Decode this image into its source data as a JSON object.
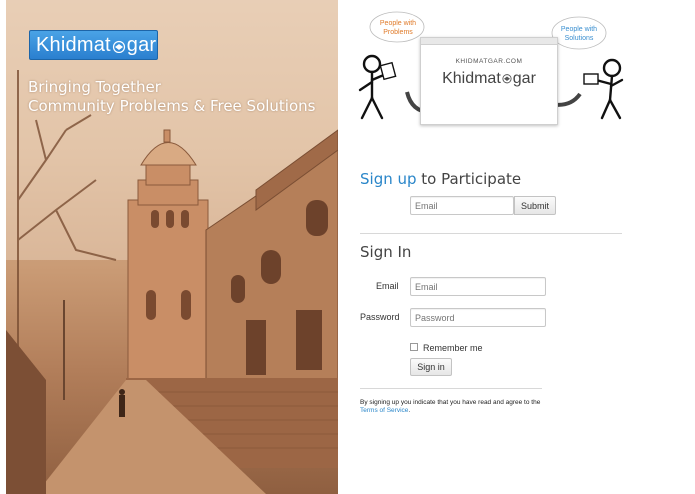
{
  "brand": {
    "logo_prefix": "Khidmat",
    "logo_suffix": "gar",
    "tagline_line1": "Bringing Together",
    "tagline_line2": "Community Problems & Free Solutions"
  },
  "illustration": {
    "left_bubble": "People with\nProblems",
    "right_bubble": "People with\nSolutions",
    "site_url": "KHIDMATGAR.COM",
    "site_name_prefix": "Khidmat",
    "site_name_suffix": "gar"
  },
  "signup": {
    "heading_highlight": "Sign up",
    "heading_rest": " to Participate",
    "email_placeholder": "Email",
    "submit_label": "Submit"
  },
  "signin": {
    "heading": "Sign In",
    "email_label": "Email",
    "email_placeholder": "Email",
    "password_label": "Password",
    "password_placeholder": "Password",
    "remember_label": "Remember me",
    "button_label": "Sign in"
  },
  "terms": {
    "text": "By signing up you indicate that you have read and agree to the ",
    "link": "Terms of Service",
    "end": "."
  },
  "colors": {
    "accent_blue": "#2a86c9",
    "logo_blue": "#3b93dd",
    "bubble_orange": "#e07b2a",
    "bubble_blue": "#3a8fd0"
  }
}
